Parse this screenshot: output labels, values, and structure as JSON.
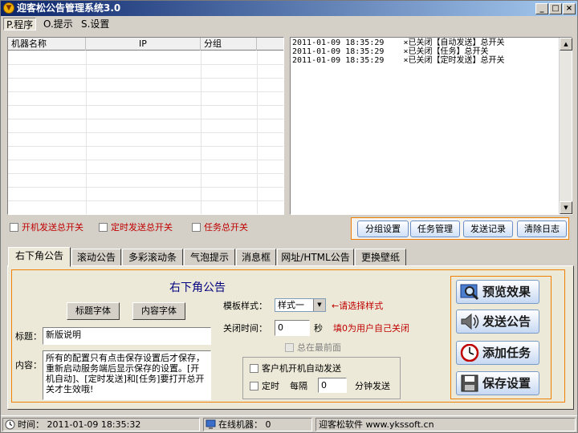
{
  "window": {
    "title": "迎客松公告管理系统3.0",
    "icon": "app-logo-icon"
  },
  "menu": {
    "items": [
      {
        "label": "P.程序"
      },
      {
        "label": "O.提示"
      },
      {
        "label": "S.设置"
      }
    ]
  },
  "grid": {
    "columns": [
      "机器名称",
      "IP",
      "分组"
    ]
  },
  "log": {
    "lines": [
      {
        "time": "2011-01-09 18:35:29",
        "msg": "×已关闭【自动发送】总开关"
      },
      {
        "time": "2011-01-09 18:35:29",
        "msg": "×已关闭【任务】总开关"
      },
      {
        "time": "2011-01-09 18:35:29",
        "msg": "×已关闭【定时发送】总开关"
      }
    ]
  },
  "switches": {
    "boot": "开机发送总开关",
    "timed": "定时发送总开关",
    "task": "任务总开关"
  },
  "actions": {
    "group": "分组设置",
    "task": "任务管理",
    "record": "发送记录",
    "clear": "清除日志"
  },
  "tabs": [
    {
      "label": "右下角公告",
      "active": true
    },
    {
      "label": "滚动公告"
    },
    {
      "label": "多彩滚动条"
    },
    {
      "label": "气泡提示"
    },
    {
      "label": "消息框"
    },
    {
      "label": "网址/HTML公告"
    },
    {
      "label": "更换壁纸"
    }
  ],
  "form": {
    "heading": "右下角公告",
    "title_font_btn": "标题字体",
    "content_font_btn": "内容字体",
    "title_label": "标题：",
    "title_value": "新版说明",
    "content_label": "内容：",
    "content_value": "所有的配置只有点击保存设置后才保存，重新启动服务端后显示保存的设置。[开机自动]、[定时发送]和[任务]要打开总开关才生效哦!",
    "template_label": "模板样式：",
    "template_value": "样式一",
    "template_hint": "←请选择样式",
    "close_label": "关闭时间：",
    "close_value": "0",
    "close_unit": "秒",
    "close_hint": "填0为用户自己关闭",
    "topmost": "总在最前面",
    "auto_send": "客户机开机自动发送",
    "timed": "定时",
    "every": "每隔",
    "interval_value": "0",
    "interval_unit": "分钟发送"
  },
  "big_buttons": {
    "preview": "预览效果",
    "send": "发送公告",
    "add_task": "添加任务",
    "save": "保存设置"
  },
  "status": {
    "time_label": "时间：",
    "time_value": "2011-01-09 18:35:32",
    "online_label": "在线机器：",
    "online_value": "0",
    "company": "迎客松软件 www.ykssoft.cn"
  },
  "colors": {
    "accent": "#f08000",
    "title_start": "#0a246a",
    "hint_red": "#c00000"
  }
}
